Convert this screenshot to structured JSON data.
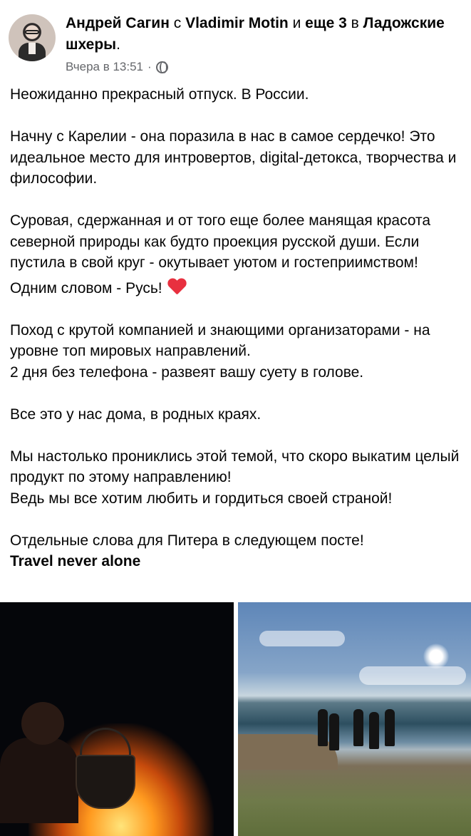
{
  "post": {
    "author": "Андрей Сагин",
    "with_word": "с",
    "tagged": "Vladimir Motin",
    "and_more_word": "и",
    "and_more": "еще 3",
    "in_word": "в",
    "location": "Ладожские шхеры",
    "timestamp": "Вчера в 13:51",
    "separator": "·",
    "privacy_icon": "globe-icon",
    "paragraphs": [
      "Неожиданно прекрасный отпуск. В России.",
      "",
      "Начну с Карелии - она поразила в нас в самое сердечко! Это идеальное место для интровертов, digital-детокса, творчества и философии.",
      "",
      "Суровая, сдержанная и от того еще более манящая красота северной природы как будто проекция русской души. Если пустила в свой круг - окутывает уютом и гостеприимством!",
      "Одним словом - Русь!",
      "",
      "Поход с крутой компанией и знающими организаторами - на уровне топ мировых направлений.",
      "2 дня без телефона - развеят вашу суету в голове.",
      "",
      "Все это у нас дома, в родных краях.",
      "",
      "Мы настолько прониклись этой темой, что скоро выкатим целый продукт по этому направлению!",
      "Ведь мы все хотим любить и гордиться своей страной!",
      "",
      "Отдельные слова для Питера в следующем посте!"
    ],
    "closing": "Travel never alone",
    "heart_icon": "heart-icon",
    "accent_colors": {
      "heart": "#e8303f",
      "meta": "#65676b"
    }
  }
}
